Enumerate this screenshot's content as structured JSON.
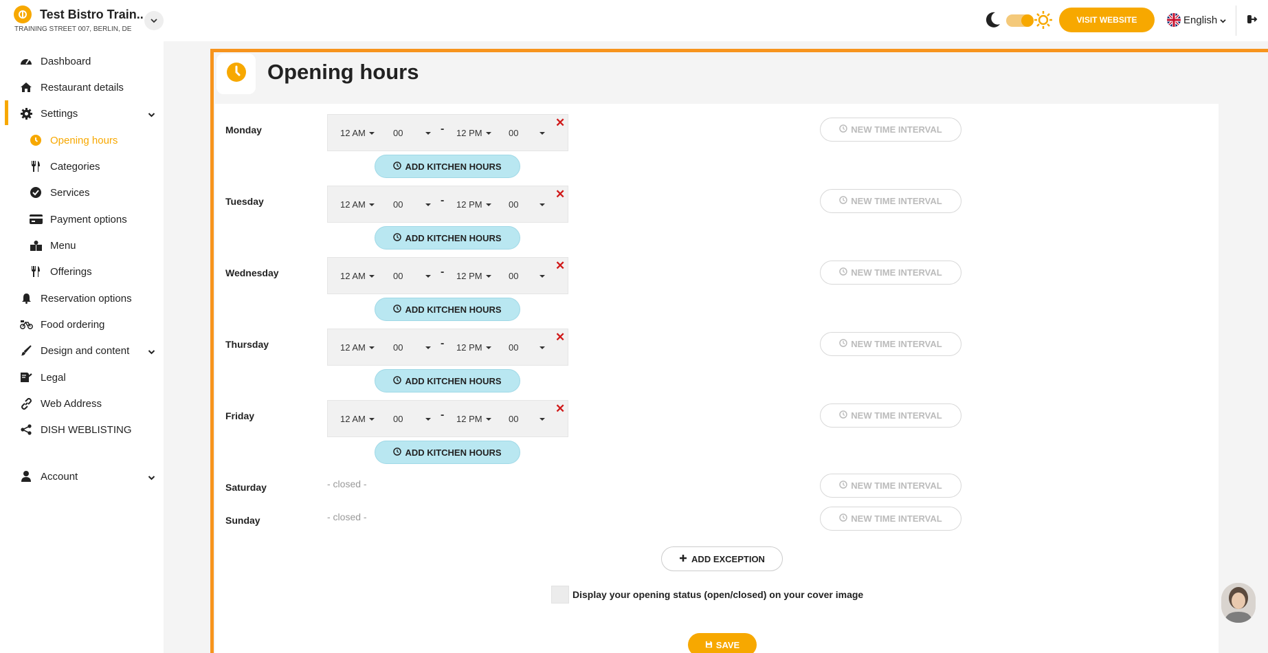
{
  "header": {
    "brand_name": "Test Bistro Train..",
    "brand_address": "TRAINING STREET 007, BERLIN, DE",
    "visit_website": "VISIT WEBSITE",
    "language": "English",
    "accent_color": "#f7a800"
  },
  "sidebar": {
    "items": [
      {
        "label": "Dashboard",
        "icon": "gauge-icon"
      },
      {
        "label": "Restaurant details",
        "icon": "home-icon"
      },
      {
        "label": "Settings",
        "icon": "gear-icon"
      },
      {
        "label": "Opening hours",
        "icon": "clock-icon"
      },
      {
        "label": "Categories",
        "icon": "utensils-icon"
      },
      {
        "label": "Services",
        "icon": "check-circle-icon"
      },
      {
        "label": "Payment options",
        "icon": "credit-card-icon"
      },
      {
        "label": "Menu",
        "icon": "menu-book-icon"
      },
      {
        "label": "Offerings",
        "icon": "utensils-icon"
      },
      {
        "label": "Reservation options",
        "icon": "bell-icon"
      },
      {
        "label": "Food ordering",
        "icon": "bike-icon"
      },
      {
        "label": "Design and content",
        "icon": "brush-icon"
      },
      {
        "label": "Legal",
        "icon": "signature-icon"
      },
      {
        "label": "Web Address",
        "icon": "link-icon"
      },
      {
        "label": "DISH WEBLISTING",
        "icon": "share-icon"
      },
      {
        "label": "Account",
        "icon": "user-icon"
      }
    ]
  },
  "page": {
    "title": "Opening hours"
  },
  "days": [
    {
      "name": "Monday",
      "open_hour": "12 AM",
      "open_min": "00",
      "close_hour": "12 PM",
      "close_min": "00"
    },
    {
      "name": "Tuesday",
      "open_hour": "12 AM",
      "open_min": "00",
      "close_hour": "12 PM",
      "close_min": "00"
    },
    {
      "name": "Wednesday",
      "open_hour": "12 AM",
      "open_min": "00",
      "close_hour": "12 PM",
      "close_min": "00"
    },
    {
      "name": "Thursday",
      "open_hour": "12 AM",
      "open_min": "00",
      "close_hour": "12 PM",
      "close_min": "00"
    },
    {
      "name": "Friday",
      "open_hour": "12 AM",
      "open_min": "00",
      "close_hour": "12 PM",
      "close_min": "00"
    },
    {
      "name": "Saturday",
      "status": "- closed -"
    },
    {
      "name": "Sunday",
      "status": "- closed -"
    }
  ],
  "labels": {
    "add_kitchen_hours": "ADD KITCHEN HOURS",
    "new_time_interval": "NEW TIME INTERVAL",
    "add_exception": "ADD EXCEPTION",
    "display_status": "Display your opening status (open/closed) on your cover image",
    "save": "SAVE",
    "dash": "-",
    "remove": "✕"
  }
}
